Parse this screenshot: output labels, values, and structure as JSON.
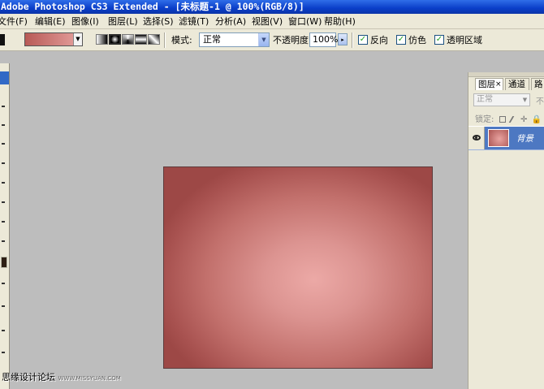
{
  "app": {
    "title": "Adobe Photoshop CS3 Extended - [未标题-1 @ 100%(RGB/8)]"
  },
  "menu": {
    "items": [
      "文件(F)",
      "编辑(E)",
      "图像(I)",
      "图层(L)",
      "选择(S)",
      "滤镜(T)",
      "分析(A)",
      "视图(V)",
      "窗口(W)",
      "帮助(H)"
    ]
  },
  "options": {
    "mode_label": "模式:",
    "mode_value": "正常",
    "opacity_label": "不透明度:",
    "opacity_value": "100%",
    "reverse_label": "反向",
    "dither_label": "仿色",
    "transparency_label": "透明区域",
    "checkmark": "✓",
    "dropdown_glyph": "▼",
    "gradient_colors": [
      "#b85a56",
      "#e7a3a0"
    ]
  },
  "canvas": {
    "gradient_type": "radial",
    "center_color": "#eca9a6",
    "edge_color": "#9d4846"
  },
  "layers_panel": {
    "tabs": [
      "图层",
      "通道",
      "路"
    ],
    "close_glyph": "×",
    "blend_mode": "正常",
    "opacity_cut": "不",
    "lock_label": "锁定:",
    "layers": [
      {
        "name": "背景",
        "visible": true,
        "selected": true
      }
    ]
  },
  "watermark": {
    "text": "思缘设计论坛",
    "sub": "WWW.MISSYUAN.COM"
  }
}
